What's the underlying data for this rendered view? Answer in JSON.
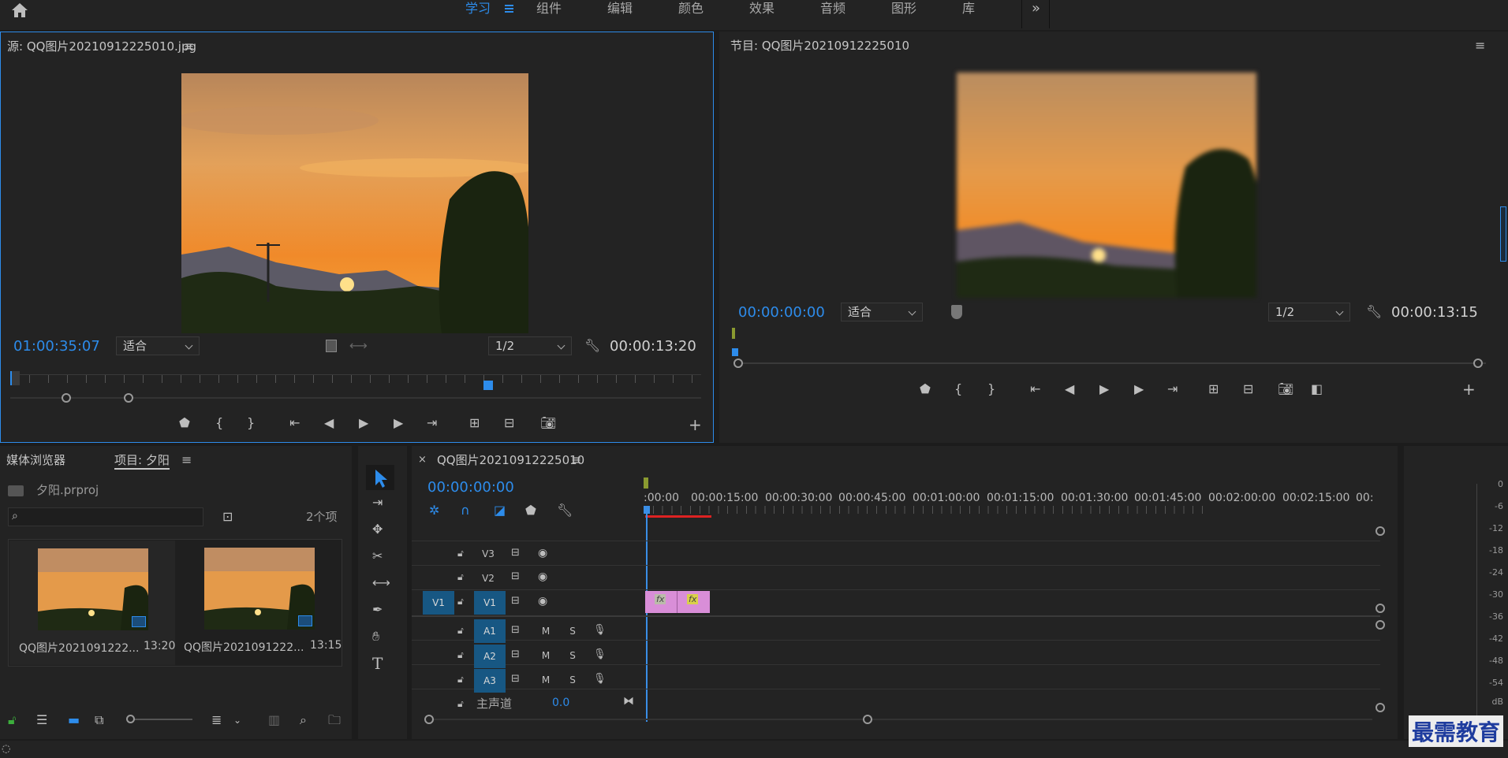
{
  "workspaces": [
    "学习",
    "组件",
    "编辑",
    "颜色",
    "效果",
    "音频",
    "图形",
    "库"
  ],
  "active_workspace": "学习",
  "source": {
    "title": "源: QQ图片20210912225010.jpg",
    "timecode": "01:00:35:07",
    "fit": "适合",
    "res": "1/2",
    "duration": "00:00:13:20"
  },
  "program": {
    "title": "节目: QQ图片20210912225010",
    "timecode": "00:00:00:00",
    "fit": "适合",
    "res": "1/2",
    "duration": "00:00:13:15"
  },
  "project": {
    "tab_media": "媒体浏览器",
    "tab_project": "项目: 夕阳",
    "file": "夕阳.prproj",
    "count": "2个项",
    "items": [
      {
        "name": "QQ图片2021091222...",
        "dur": "13:20"
      },
      {
        "name": "QQ图片2021091222...",
        "dur": "13:15"
      }
    ]
  },
  "timeline": {
    "title": "QQ图片20210912225010",
    "timecode": "00:00:00:00",
    "ruler": [
      ":00:00",
      "00:00:15:00",
      "00:00:30:00",
      "00:00:45:00",
      "00:01:00:00",
      "00:01:15:00",
      "00:01:30:00",
      "00:01:45:00",
      "00:02:00:00",
      "00:02:15:00",
      "00:"
    ],
    "video_tracks": [
      "V3",
      "V2",
      "V1"
    ],
    "audio_tracks": [
      "A1",
      "A2",
      "A3"
    ],
    "src_v": "V1",
    "mute": "M",
    "solo": "S",
    "master": "主声道",
    "master_val": "0.0",
    "fx": "fx"
  },
  "meter": [
    "0",
    "-6",
    "-12",
    "-18",
    "-24",
    "-30",
    "-36",
    "-42",
    "-48",
    "-54",
    "dB"
  ],
  "watermark": "最需教育",
  "colors": {
    "accent": "#2d8ceb",
    "track_blue": "#175783",
    "clip": "#d98ed8",
    "playhead": "#3a8ee6"
  }
}
